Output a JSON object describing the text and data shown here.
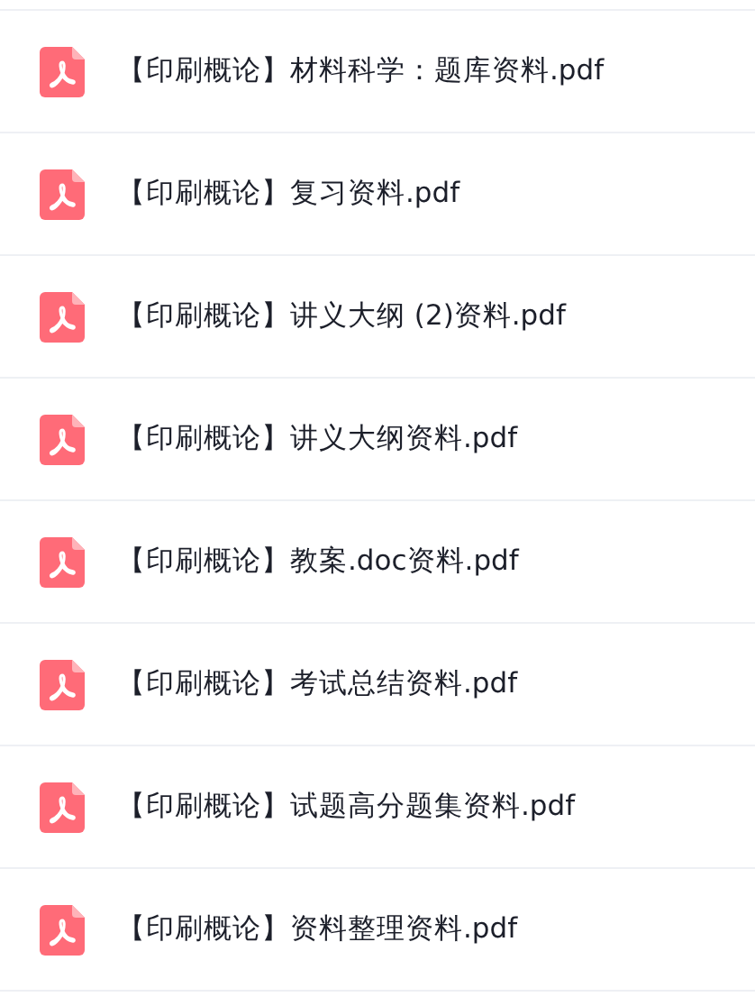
{
  "files": [
    {
      "name": "【印刷概论】材料科学：题库资料.pdf"
    },
    {
      "name": "【印刷概论】复习资料.pdf"
    },
    {
      "name": "【印刷概论】讲义大纲 (2)资料.pdf"
    },
    {
      "name": "【印刷概论】讲义大纲资料.pdf"
    },
    {
      "name": "【印刷概论】教案.doc资料.pdf"
    },
    {
      "name": "【印刷概论】考试总结资料.pdf"
    },
    {
      "name": "【印刷概论】试题高分题集资料.pdf"
    },
    {
      "name": "【印刷概论】资料整理资料.pdf"
    }
  ]
}
